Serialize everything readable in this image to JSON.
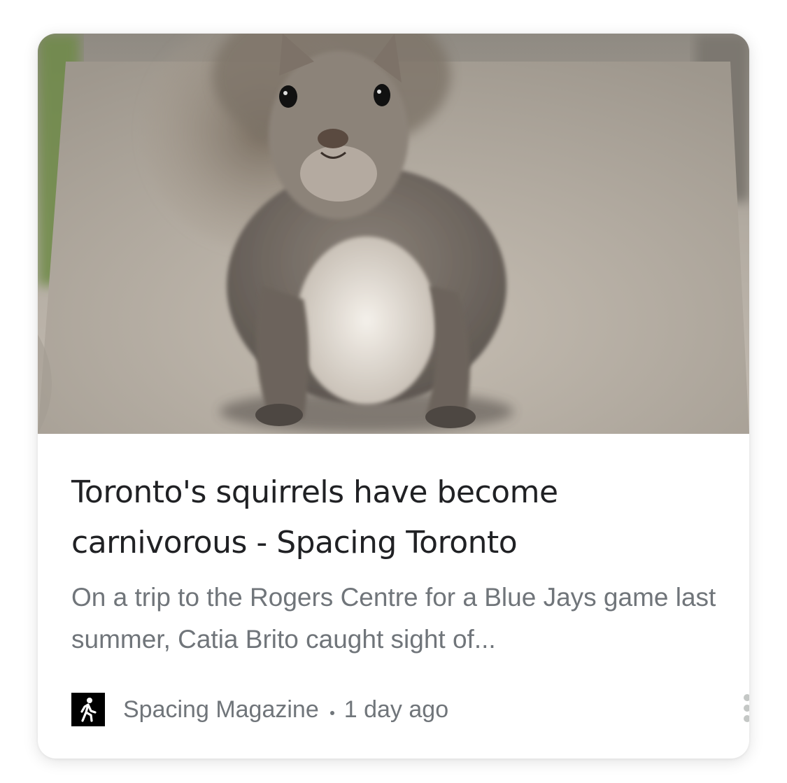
{
  "card": {
    "image_alt": "Squirrel on a concrete ledge",
    "headline": "Toronto's squirrels have become carnivorous - Spacing Toronto",
    "snippet": "On a trip to the Rogers Centre for a Blue Jays game last summer, Catia Brito caught sight of...",
    "source": {
      "icon": "walking-person-icon",
      "name": "Spacing Magazine",
      "separator": "•",
      "time": "1 day ago"
    },
    "menu_icon": "more-vert-icon"
  },
  "colors": {
    "headline": "#202124",
    "secondary_text": "#70757a",
    "card_background": "#ffffff"
  }
}
